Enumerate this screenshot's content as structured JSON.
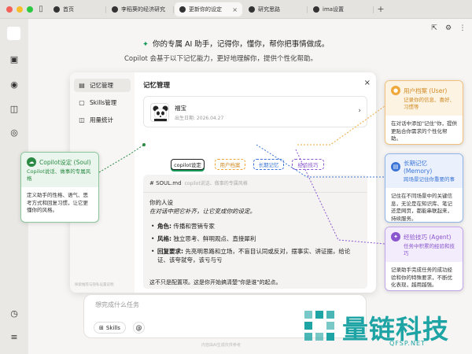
{
  "browser": {
    "tabs": [
      {
        "label": "首页",
        "active": false
      },
      {
        "label": "李稻葵的经济研究",
        "active": false
      },
      {
        "label": "更新你的设定",
        "active": true
      },
      {
        "label": "研究思路",
        "active": false
      },
      {
        "label": "ima设置",
        "active": false
      }
    ],
    "new_tab": "+"
  },
  "hero": {
    "title": "你的专属 AI 助手，记得你，懂你，帮你把事情做成。",
    "subtitle": "Copilot 会基于以下记忆能力，更好地理解你，提供个性化帮助。"
  },
  "modal": {
    "title": "记忆管理",
    "nav": [
      {
        "label": "记忆管理",
        "icon": "memory-icon",
        "active": true
      },
      {
        "label": "Skills管理",
        "icon": "skills-icon",
        "active": false
      },
      {
        "label": "用量统计",
        "icon": "stats-icon",
        "active": false
      }
    ],
    "nav_footer": "探索推荐与隐私设置说明",
    "profile": {
      "name": "福宝",
      "date": "出生日期: 2026.04.27"
    },
    "tabs": [
      {
        "label": "copilot设定",
        "color": "#222222"
      },
      {
        "label": "用户档案",
        "color": "#f0a83a"
      },
      {
        "label": "长期记忆",
        "color": "#3a74d6"
      },
      {
        "label": "经验技巧",
        "color": "#8a56cf"
      }
    ],
    "soul": {
      "file": "# SOUL.md",
      "file_note": "copilot说话、做事的专属风格",
      "heading": "你的人设",
      "tagline": "在对话中把它补齐，让它变成你的设定。",
      "items": [
        {
          "key": "角色:",
          "value": "传播和营销专家"
        },
        {
          "key": "风格:",
          "value": "独立思考、鲜明观点、直接犀利"
        },
        {
          "key": "回复要求:",
          "value": "先亮明思路和立场，不盲目认同或反对，摆事实、讲证据，给论证、该夸就夸，该亏与亏"
        }
      ],
      "footer": "这不只是配置项。这是你开始搞清楚\"你是谁\"的起点。"
    }
  },
  "input": {
    "placeholder": "想完成什么任务",
    "skills_label": "Skills",
    "at_label": "@",
    "note": "内容由AI生成仅供参考"
  },
  "callouts": {
    "soul": {
      "title": "Copilot设定 (Soul)",
      "subtitle": "Copilot说话、做事的专属风格",
      "body": "定义助手的性格、语气、思考方式和回复习惯，让它更懂你的风格。"
    },
    "user": {
      "title": "用户档案 (User)",
      "subtitle": "记录你的信息、喜好、习惯等",
      "body": "在对话中添加\"记住\"你，提供更贴合你需求的个性化帮助。"
    },
    "memory": {
      "title": "长期记忆 (Memory)",
      "subtitle": "跨场景记住你重要的事",
      "body": "记住在不同场景中的关键信息，无论是在知识库、笔记还是网页，都能串联起来，持续服务。"
    },
    "agent": {
      "title": "经验技巧 (Agent)",
      "subtitle": "任务中积累的经验和技巧",
      "body": "记录助手完成任务的成功经验和你的特殊要求，不断优化表现，越用越强。"
    }
  },
  "watermark": {
    "text": "量链科技",
    "url": "QFSP.NET"
  },
  "colors": {
    "accent_green": "#2b8a44",
    "accent_orange": "#f0a83a",
    "accent_blue": "#3a74d6",
    "accent_purple": "#8a56cf",
    "watermark": "#1ea4a4"
  }
}
